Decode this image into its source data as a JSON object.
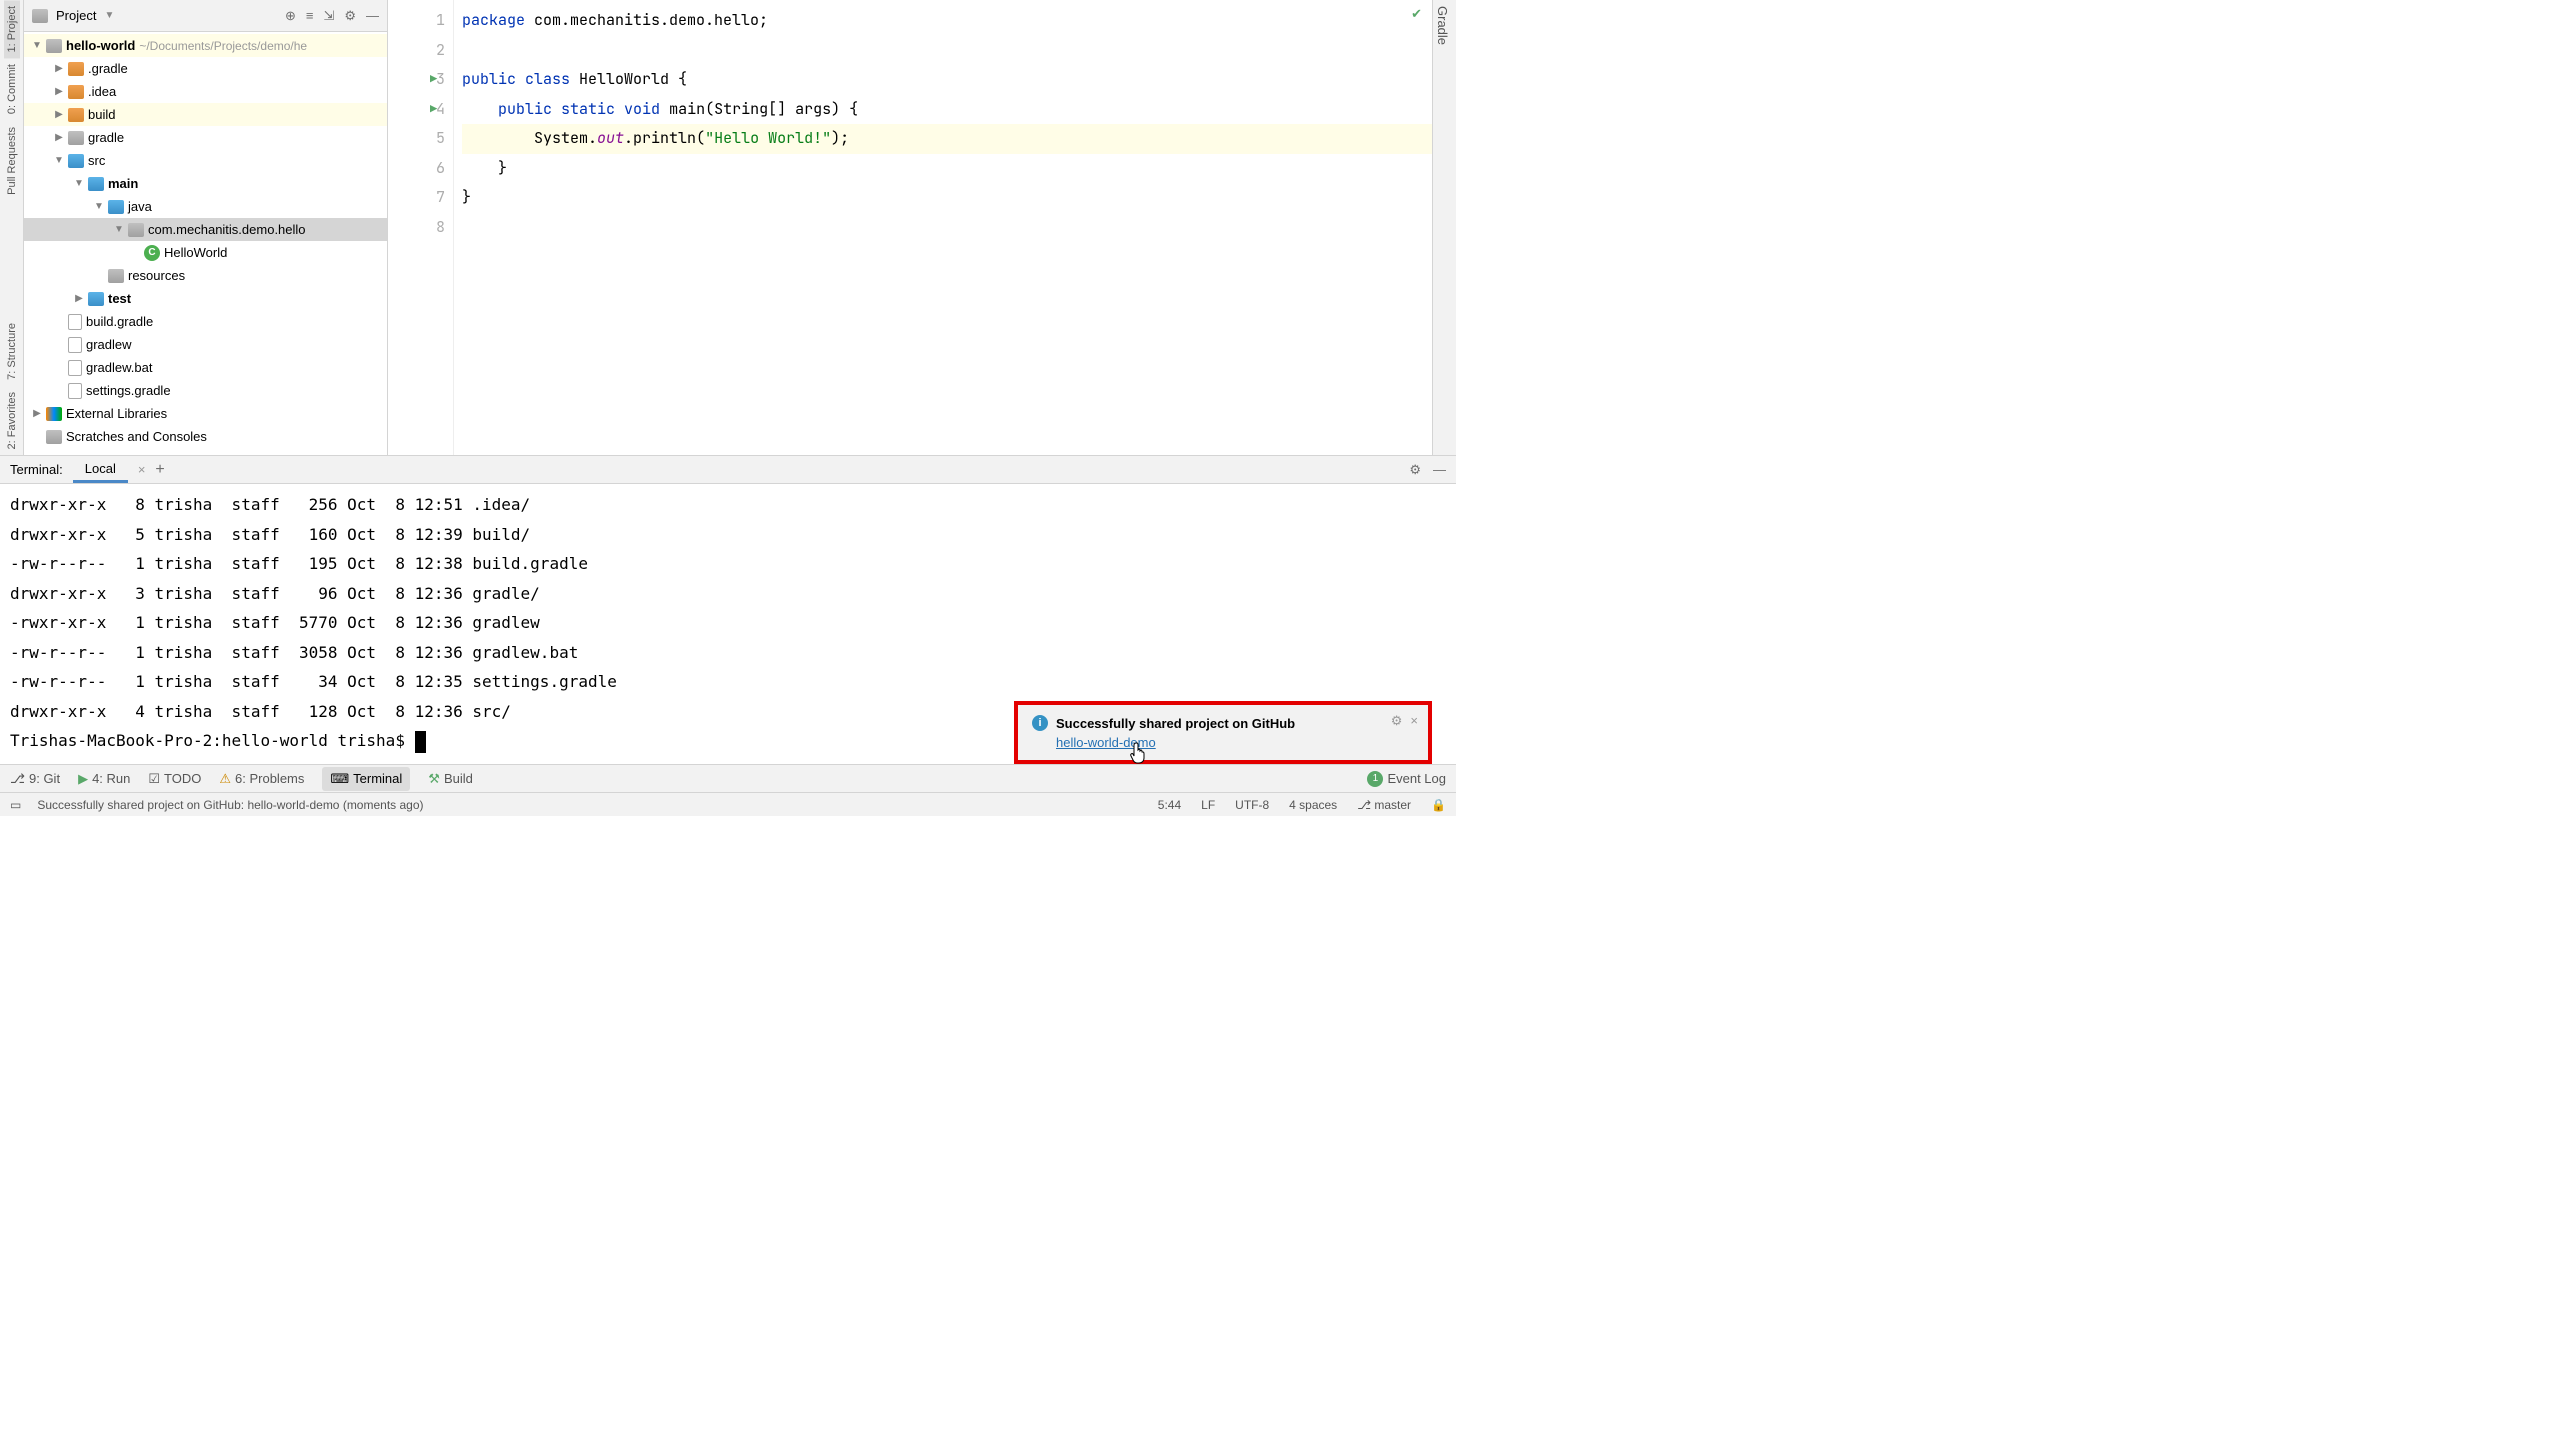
{
  "project_panel": {
    "title": "Project",
    "tree": {
      "root_name": "hello-world",
      "root_path": "~/Documents/Projects/demo/he",
      "gradle_dir": ".gradle",
      "idea_dir": ".idea",
      "build_dir": "build",
      "gradle_folder": "gradle",
      "src_dir": "src",
      "main_dir": "main",
      "java_dir": "java",
      "package": "com.mechanitis.demo.hello",
      "class_file": "HelloWorld",
      "resources_dir": "resources",
      "test_dir": "test",
      "build_gradle": "build.gradle",
      "gradlew": "gradlew",
      "gradlew_bat": "gradlew.bat",
      "settings_gradle": "settings.gradle",
      "external_libs": "External Libraries",
      "scratches": "Scratches and Consoles"
    }
  },
  "left_rail": {
    "project": "1: Project",
    "commit": "0: Commit",
    "pull_requests": "Pull Requests",
    "structure": "7: Structure",
    "favorites": "2: Favorites"
  },
  "right_rail": {
    "gradle": "Gradle"
  },
  "editor": {
    "lines": [
      "1",
      "2",
      "3",
      "4",
      "5",
      "6",
      "7",
      "8"
    ],
    "code": {
      "l1_pkg": "package",
      "l1_rest": " com.mechanitis.demo.hello;",
      "l3_pub": "public",
      "l3_class": " class",
      "l3_name": " HelloWorld {",
      "l4_pub": "public",
      "l4_static": " static",
      "l4_void": " void",
      "l4_main": " main",
      "l4_args": "(String[] args) {",
      "l5_sys": "System.",
      "l5_out": "out",
      "l5_println": ".println(",
      "l5_str": "\"Hello World!\"",
      "l5_end": ");",
      "l6": "}",
      "l7": "}"
    }
  },
  "terminal": {
    "title": "Terminal:",
    "tab": "Local",
    "lines": [
      "drwxr-xr-x   8 trisha  staff   256 Oct  8 12:51 .idea/",
      "drwxr-xr-x   5 trisha  staff   160 Oct  8 12:39 build/",
      "-rw-r--r--   1 trisha  staff   195 Oct  8 12:38 build.gradle",
      "drwxr-xr-x   3 trisha  staff    96 Oct  8 12:36 gradle/",
      "-rwxr-xr-x   1 trisha  staff  5770 Oct  8 12:36 gradlew",
      "-rw-r--r--   1 trisha  staff  3058 Oct  8 12:36 gradlew.bat",
      "-rw-r--r--   1 trisha  staff    34 Oct  8 12:35 settings.gradle",
      "drwxr-xr-x   4 trisha  staff   128 Oct  8 12:36 src/"
    ],
    "prompt": "Trishas-MacBook-Pro-2:hello-world trisha$ "
  },
  "notification": {
    "title": "Successfully shared project on GitHub",
    "link": "hello-world-demo"
  },
  "bottom_bar": {
    "git": "9: Git",
    "run": "4: Run",
    "todo": "TODO",
    "problems": "6: Problems",
    "terminal": "Terminal",
    "build": "Build",
    "event_log": "Event Log"
  },
  "status_bar": {
    "message": "Successfully shared project on GitHub: hello-world-demo (moments ago)",
    "caret": "5:44",
    "line_sep": "LF",
    "encoding": "UTF-8",
    "indent": "4 spaces",
    "branch": "master",
    "event_badge": "1"
  }
}
